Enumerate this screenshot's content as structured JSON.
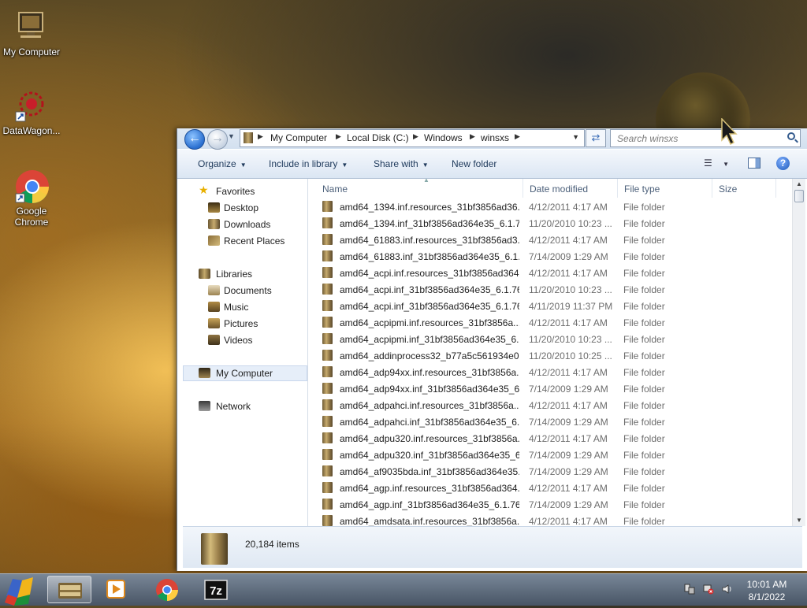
{
  "desktop": {
    "icons": [
      {
        "label": "My Computer"
      },
      {
        "label": "DataWagon..."
      },
      {
        "label": "Google Chrome"
      }
    ]
  },
  "explorer": {
    "breadcrumb": [
      "My Computer",
      "Local Disk (C:)",
      "Windows",
      "winsxs"
    ],
    "search": {
      "placeholder": "Search winsxs"
    },
    "toolbar": {
      "organize": "Organize",
      "include_in_library": "Include in library",
      "share_with": "Share with",
      "new_folder": "New folder"
    },
    "nav": {
      "favorites": "Favorites",
      "desktop": "Desktop",
      "downloads": "Downloads",
      "recent_places": "Recent Places",
      "libraries": "Libraries",
      "documents": "Documents",
      "music": "Music",
      "pictures": "Pictures",
      "videos": "Videos",
      "my_computer": "My Computer",
      "network": "Network"
    },
    "columns": {
      "name": "Name",
      "date_modified": "Date modified",
      "type": "File type",
      "size": "Size"
    },
    "files": [
      {
        "name": "amd64_1394.inf.resources_31bf3856ad36...",
        "date": "4/12/2011 4:17 AM",
        "type": "File folder"
      },
      {
        "name": "amd64_1394.inf_31bf3856ad364e35_6.1.7...",
        "date": "11/20/2010 10:23 ...",
        "type": "File folder"
      },
      {
        "name": "amd64_61883.inf.resources_31bf3856ad3...",
        "date": "4/12/2011 4:17 AM",
        "type": "File folder"
      },
      {
        "name": "amd64_61883.inf_31bf3856ad364e35_6.1....",
        "date": "7/14/2009 1:29 AM",
        "type": "File folder"
      },
      {
        "name": "amd64_acpi.inf.resources_31bf3856ad364...",
        "date": "4/12/2011 4:17 AM",
        "type": "File folder"
      },
      {
        "name": "amd64_acpi.inf_31bf3856ad364e35_6.1.76...",
        "date": "11/20/2010 10:23 ...",
        "type": "File folder"
      },
      {
        "name": "amd64_acpi.inf_31bf3856ad364e35_6.1.76...",
        "date": "4/11/2019 11:37 PM",
        "type": "File folder"
      },
      {
        "name": "amd64_acpipmi.inf.resources_31bf3856a...",
        "date": "4/12/2011 4:17 AM",
        "type": "File folder"
      },
      {
        "name": "amd64_acpipmi.inf_31bf3856ad364e35_6....",
        "date": "11/20/2010 10:23 ...",
        "type": "File folder"
      },
      {
        "name": "amd64_addinprocess32_b77a5c561934e0...",
        "date": "11/20/2010 10:25 ...",
        "type": "File folder"
      },
      {
        "name": "amd64_adp94xx.inf.resources_31bf3856a...",
        "date": "4/12/2011 4:17 AM",
        "type": "File folder"
      },
      {
        "name": "amd64_adp94xx.inf_31bf3856ad364e35_6....",
        "date": "7/14/2009 1:29 AM",
        "type": "File folder"
      },
      {
        "name": "amd64_adpahci.inf.resources_31bf3856a...",
        "date": "4/12/2011 4:17 AM",
        "type": "File folder"
      },
      {
        "name": "amd64_adpahci.inf_31bf3856ad364e35_6....",
        "date": "7/14/2009 1:29 AM",
        "type": "File folder"
      },
      {
        "name": "amd64_adpu320.inf.resources_31bf3856a...",
        "date": "4/12/2011 4:17 AM",
        "type": "File folder"
      },
      {
        "name": "amd64_adpu320.inf_31bf3856ad364e35_6....",
        "date": "7/14/2009 1:29 AM",
        "type": "File folder"
      },
      {
        "name": "amd64_af9035bda.inf_31bf3856ad364e35...",
        "date": "7/14/2009 1:29 AM",
        "type": "File folder"
      },
      {
        "name": "amd64_agp.inf.resources_31bf3856ad364...",
        "date": "4/12/2011 4:17 AM",
        "type": "File folder"
      },
      {
        "name": "amd64_agp.inf_31bf3856ad364e35_6.1.76...",
        "date": "7/14/2009 1:29 AM",
        "type": "File folder"
      },
      {
        "name": "amd64_amdsata.inf.resources_31bf3856a...",
        "date": "4/12/2011 4:17 AM",
        "type": "File folder"
      }
    ],
    "status": {
      "item_count": "20,184 items"
    }
  },
  "taskbar": {
    "clock": {
      "time": "10:01 AM",
      "date": "8/1/2022"
    }
  }
}
